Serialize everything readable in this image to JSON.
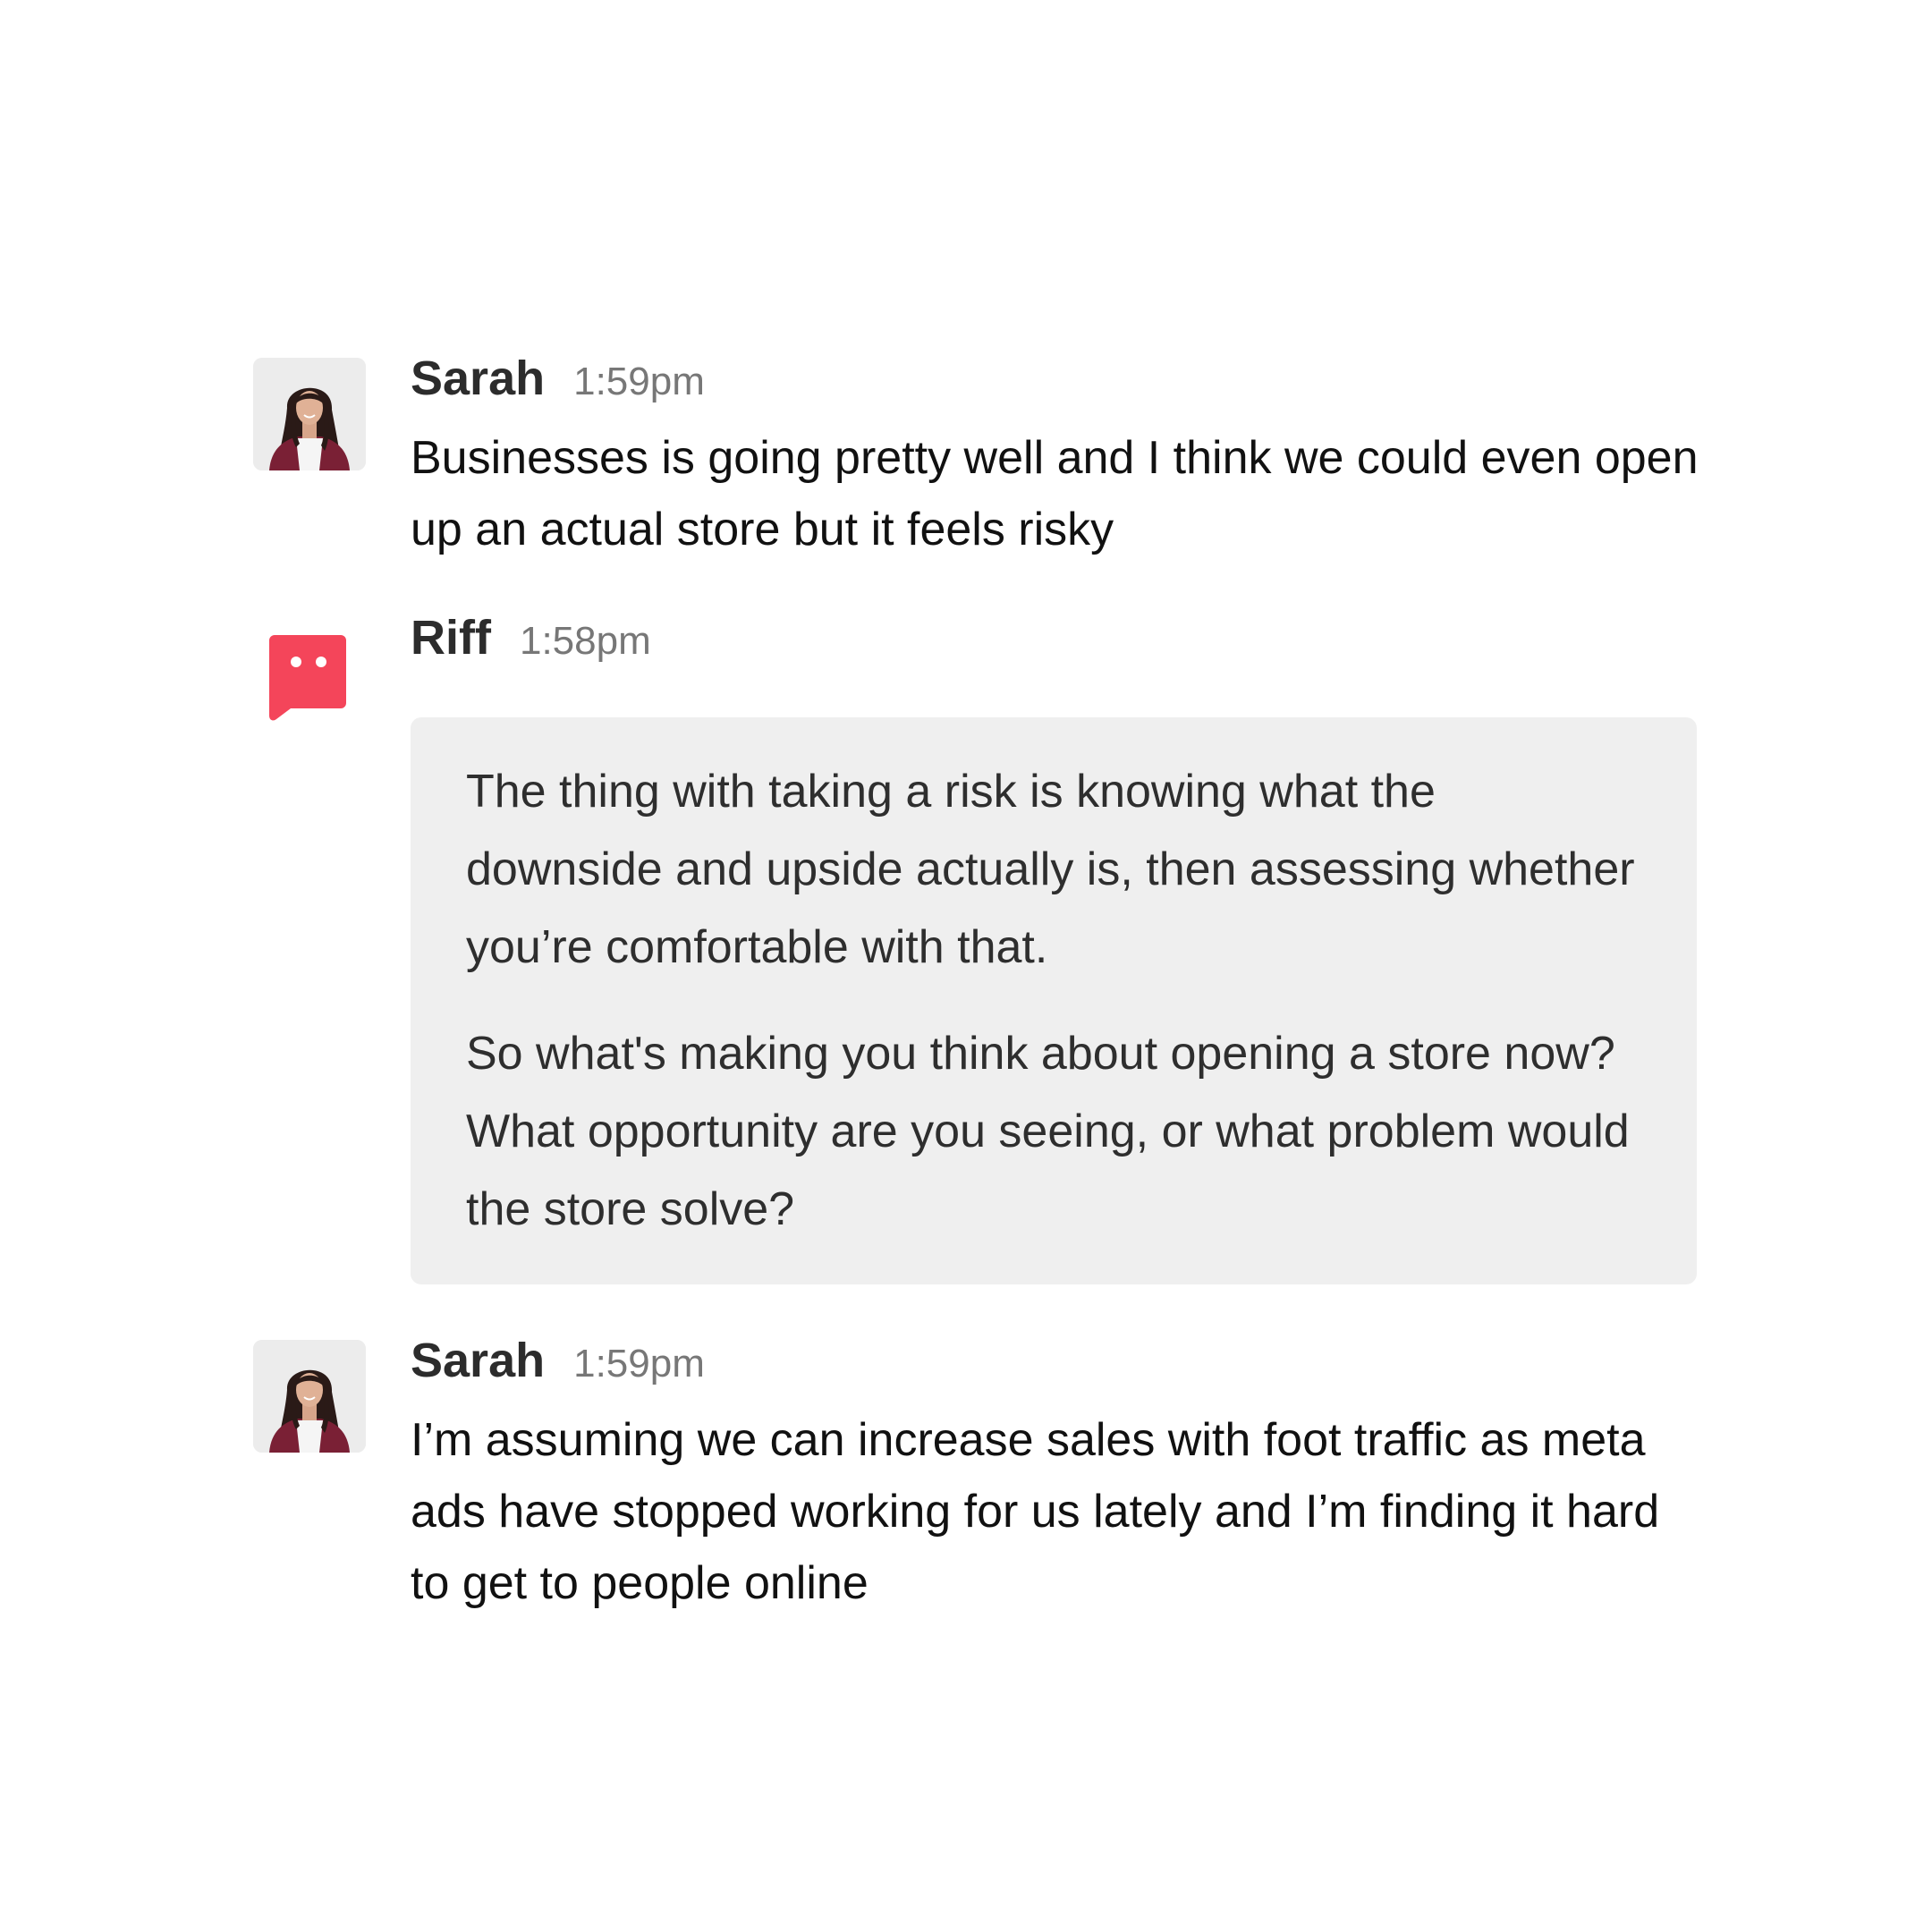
{
  "messages": [
    {
      "sender": "Sarah",
      "time": "1:59pm",
      "avatar_icon": "user-photo-avatar",
      "text": "Businesses is going pretty well and I think we could even open up an actual store but it feels risky"
    },
    {
      "sender": "Riff",
      "time": "1:58pm",
      "avatar_icon": "chat-bubble-bot-icon",
      "avatar_color": "#f4455a",
      "paragraphs": [
        "The thing with taking a risk is knowing what the downside and upside actually is, then assessing whether you’re comfortable with that.",
        "So what's making you think about opening a store now? What opportunity are you seeing, or what problem would the store solve?"
      ]
    },
    {
      "sender": "Sarah",
      "time": "1:59pm",
      "avatar_icon": "user-photo-avatar",
      "text": "I’m assuming we can increase sales with foot traffic as meta ads have stopped working for us lately and I’m finding it hard to get to people online"
    }
  ],
  "colors": {
    "bubble_background": "#efefef",
    "bot_accent": "#f4455a",
    "name_text": "#2c2c2c",
    "time_text": "#777777"
  }
}
